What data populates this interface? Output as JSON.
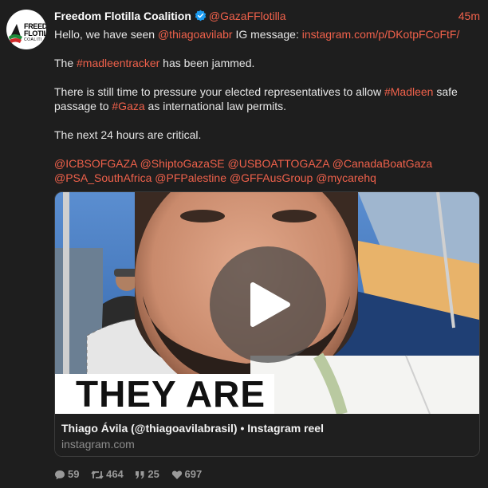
{
  "author": {
    "display_name": "Freedom Flotilla Coalition",
    "handle": "@GazaFFlotilla",
    "timestamp": "45m",
    "avatar_logo_lines": [
      "FREEDO",
      "FLOTIL",
      "COALITI"
    ]
  },
  "post": {
    "line1_prefix": "Hello, we have seen ",
    "mention_thiago": "@thiagoavilabr",
    "line1_mid": " IG message: ",
    "ig_link": "instagram.com/p/DKotpFCoFtF/",
    "line2_prefix": "The ",
    "hashtag_tracker": "#madleentracker",
    "line2_suffix": " has been jammed.",
    "line3_prefix": "There is still time to pressure your elected representatives to allow ",
    "hashtag_madleen": "#Madleen",
    "line3_mid": " safe passage to ",
    "hashtag_gaza": "#Gaza",
    "line3_suffix": " as international law permits.",
    "line4": "The next 24 hours are critical.",
    "mentions": [
      "@ICBSOFGAZA",
      "@ShiptoGazaSE",
      "@USBOATTOGAZA",
      "@CanadaBoatGaza",
      "@PSA_SouthAfrica",
      "@PFPalestine",
      "@GFFAusGroup",
      "@mycarehq"
    ]
  },
  "card": {
    "video_caption": "THEY ARE",
    "title": "Thiago Ávila (@thiagoavilabrasil) • Instagram reel",
    "domain": "instagram.com"
  },
  "stats": {
    "replies": "59",
    "reposts": "464",
    "quotes": "25",
    "likes": "697"
  },
  "colors": {
    "background": "#1e1e1e",
    "accent": "#f0614b",
    "verified": "#1d9bf0"
  },
  "icons": [
    "verified-badge-icon",
    "play-icon",
    "reply-icon",
    "repost-icon",
    "quote-icon",
    "heart-icon"
  ]
}
